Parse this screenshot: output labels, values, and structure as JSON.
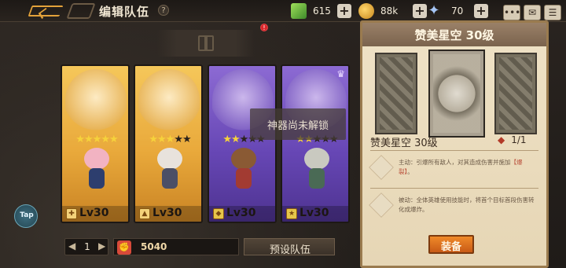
{
  "header": {
    "title": "编辑队伍",
    "help_icon": "question-icon"
  },
  "resources": [
    {
      "name": "gem",
      "icon": "green-cube-icon",
      "value": "615"
    },
    {
      "name": "coin",
      "icon": "coin-icon",
      "value": "88k"
    },
    {
      "name": "star",
      "icon": "star-icon",
      "value": "70"
    }
  ],
  "top_buttons": [
    {
      "name": "chat",
      "icon": "chat-icon",
      "glyph": "•••"
    },
    {
      "name": "mail",
      "icon": "mail-icon",
      "glyph": "✉"
    },
    {
      "name": "menu",
      "icon": "menu-icon",
      "glyph": "☰"
    }
  ],
  "artifact_slot": {
    "badge": "!"
  },
  "heroes": [
    {
      "stars": 5,
      "stars_on": 5,
      "class_symbol": "✚",
      "level": "Lv30",
      "rarity": "gold"
    },
    {
      "stars": 5,
      "stars_on": 3,
      "class_symbol": "▲",
      "level": "Lv30",
      "rarity": "gold"
    },
    {
      "stars": 5,
      "stars_on": 2,
      "class_symbol": "◆",
      "level": "Lv30",
      "rarity": "purple"
    },
    {
      "stars": 5,
      "stars_on": 2,
      "class_symbol": "★",
      "level": "Lv30",
      "rarity": "purple"
    }
  ],
  "locked_text": "神器尚未解锁",
  "bottom": {
    "page_num": "1",
    "prev": "◀",
    "next": "▶",
    "power": "5040",
    "preset_label": "预设队伍"
  },
  "tap_label": "Tap",
  "detail": {
    "title": "赞美星空 30级",
    "name": "赞美星空 30级",
    "count": "1/1",
    "active_skill": {
      "prefix": "主动：引爆所有敌人，对其造成伤害并施加",
      "highlight": "【爆裂】",
      "suffix": "。"
    },
    "passive_skill": "被动：全体英雄使用技能时，将首个目标首段伤害转化成爆炸。",
    "equip_label": "装备",
    "close": "✕"
  }
}
